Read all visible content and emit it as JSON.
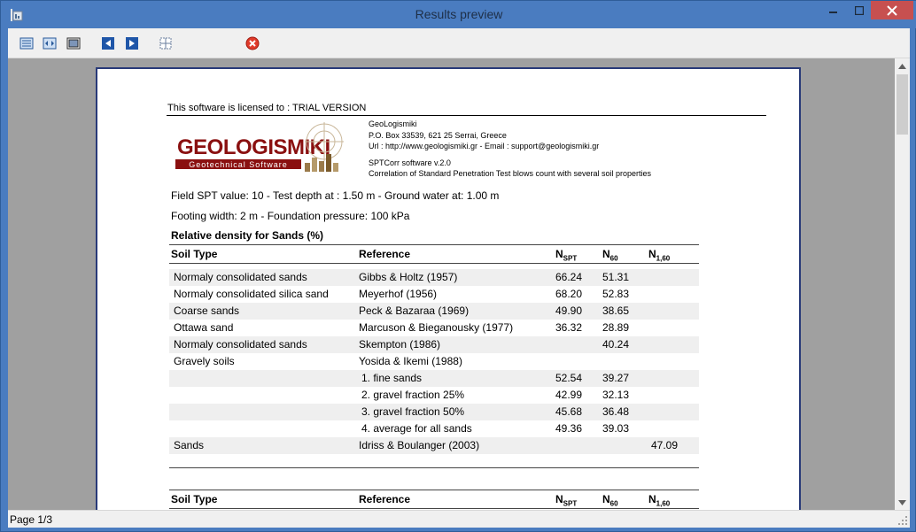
{
  "window": {
    "title": "Results preview"
  },
  "toolbar": {
    "buttons": [
      {
        "name": "page-view-icon"
      },
      {
        "name": "page-width-icon"
      },
      {
        "name": "full-page-icon"
      },
      {
        "name": "previous-page-icon"
      },
      {
        "name": "next-page-icon"
      },
      {
        "name": "page-setup-icon"
      },
      {
        "name": "close-preview-icon"
      }
    ]
  },
  "status": {
    "page": "Page 1/3"
  },
  "report": {
    "license": "This software is licensed to : TRIAL VERSION",
    "logo": {
      "text": "GEOLOGISMIKI",
      "subtitle": "Geotechnical Software"
    },
    "company": {
      "name": "GeoLogismiki",
      "address": "P.O. Box 33539, 621 25 Serrai, Greece",
      "contact": "Url : http://www.geologismiki.gr - Email : support@geologismiki.gr",
      "software": "SPTCorr software v.2.0",
      "description": "Correlation of Standard Penetration Test blows count with several soil properties"
    },
    "params": {
      "line1": "Field SPT value: 10 - Test depth at : 1.50 m - Ground water at: 1.00 m",
      "line2": "Footing width: 2 m - Foundation pressure: 100 kPa"
    },
    "section_title": "Relative density for Sands (%)",
    "headers": {
      "soil": "Soil Type",
      "reference": "Reference",
      "nspt_base": "N",
      "nspt_sub": "SPT",
      "n60_base": "N",
      "n60_sub": "60",
      "n160_base": "N",
      "n160_sub": "1,60"
    },
    "rows": [
      {
        "soil": "Normaly consolidated sands",
        "ref": "Gibbs & Holtz (1957)",
        "nspt": "66.24",
        "n60": "51.31",
        "n160": ""
      },
      {
        "soil": "Normaly consolidated silica sand",
        "ref": "Meyerhof (1956)",
        "nspt": "68.20",
        "n60": "52.83",
        "n160": ""
      },
      {
        "soil": "Coarse sands",
        "ref": "Peck & Bazaraa (1969)",
        "nspt": "49.90",
        "n60": "38.65",
        "n160": ""
      },
      {
        "soil": "Ottawa sand",
        "ref": "Marcuson & Bieganousky (1977)",
        "nspt": "36.32",
        "n60": "28.89",
        "n160": ""
      },
      {
        "soil": "Normaly consolidated sands",
        "ref": "Skempton (1986)",
        "nspt": "",
        "n60": "40.24",
        "n160": ""
      },
      {
        "soil": "Gravely soils",
        "ref": "Yosida & Ikemi (1988)",
        "nspt": "",
        "n60": "",
        "n160": ""
      },
      {
        "soil": "",
        "ref": "1. fine sands",
        "nspt": "52.54",
        "n60": "39.27",
        "n160": ""
      },
      {
        "soil": "",
        "ref": "2. gravel fraction 25%",
        "nspt": "42.99",
        "n60": "32.13",
        "n160": ""
      },
      {
        "soil": "",
        "ref": "3. gravel fraction 50%",
        "nspt": "45.68",
        "n60": "36.48",
        "n160": ""
      },
      {
        "soil": "",
        "ref": "4. average for all sands",
        "nspt": "49.36",
        "n60": "39.03",
        "n160": ""
      },
      {
        "soil": "Sands",
        "ref": "Idriss & Boulanger (2003)",
        "nspt": "",
        "n60": "",
        "n160": "47.09"
      }
    ],
    "table2_headers": {
      "soil": "Soil Type",
      "reference": "Reference",
      "nspt_base": "N",
      "nspt_sub": "SPT",
      "n60_base": "N",
      "n60_sub": "60",
      "n160_base": "N",
      "n160_sub": "1,60"
    }
  }
}
